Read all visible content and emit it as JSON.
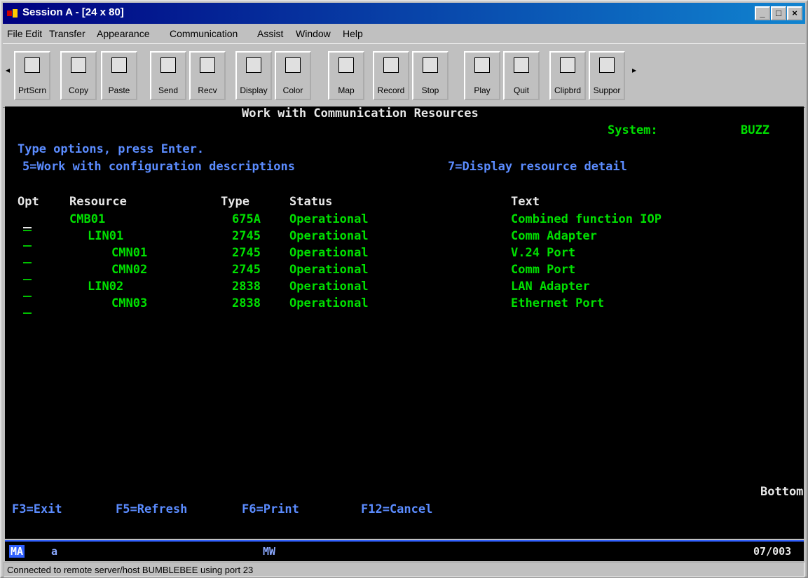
{
  "window": {
    "title": "Session A - [24 x 80]"
  },
  "menu": [
    "File",
    "Edit",
    "Transfer",
    "Appearance",
    "Communication",
    "Assist",
    "Window",
    "Help"
  ],
  "toolbar": [
    "PrtScrn",
    "Copy",
    "Paste",
    "Send",
    "Recv",
    "Display",
    "Color",
    "Map",
    "Record",
    "Stop",
    "Play",
    "Quit",
    "Clipbrd",
    "Suppor"
  ],
  "screen": {
    "title": "Work with Communication Resources",
    "system_label": "System:",
    "system_value": "BUZZ",
    "instructions": "Type options, press Enter.",
    "option5": "5=Work with configuration descriptions",
    "option7": "7=Display resource detail",
    "headers": {
      "opt": "Opt",
      "resource": "Resource",
      "type": "Type",
      "status": "Status",
      "text": "Text"
    },
    "rows": [
      {
        "opt": "",
        "resource": "CMB01",
        "type": "675A",
        "status": "Operational",
        "text": "Combined function IOP"
      },
      {
        "opt": "",
        "resource": "LIN01",
        "type": "2745",
        "status": "Operational",
        "text": "Comm Adapter"
      },
      {
        "opt": "",
        "resource": "CMN01",
        "type": "2745",
        "status": "Operational",
        "text": "V.24 Port"
      },
      {
        "opt": "",
        "resource": "CMN02",
        "type": "2745",
        "status": "Operational",
        "text": "Comm Port"
      },
      {
        "opt": "",
        "resource": "LIN02",
        "type": "2838",
        "status": "Operational",
        "text": "LAN Adapter"
      },
      {
        "opt": "",
        "resource": "CMN03",
        "type": "2838",
        "status": "Operational",
        "text": "Ethernet Port"
      }
    ],
    "more": "Bottom",
    "fkeys": [
      "F3=Exit",
      "F5=Refresh",
      "F6=Print",
      "F12=Cancel"
    ]
  },
  "oia": {
    "session": "MA",
    "shift": "a",
    "mode": "MW",
    "cursor": "07/003"
  },
  "statusbar": "Connected to remote server/host BUMBLEBEE using port 23",
  "colors": {
    "field_green": "#00e000",
    "field_blue": "#5b8cff",
    "title_bar": "#000080"
  }
}
